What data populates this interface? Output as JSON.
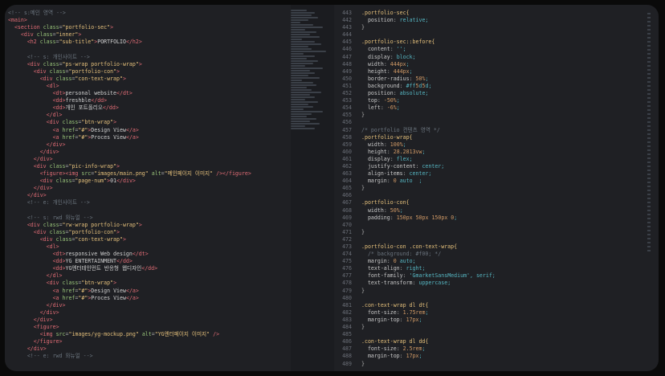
{
  "left_code": [
    "<!-- s:메인 영역 -->",
    "<main>",
    "  <section class=\"portfolio-sec\">",
    "    <div class=\"inner\">",
    "      <h2 class=\"sub-title\">PORTFOLIO</h2>",
    "",
    "      <!-- s: 개인사이트 -->",
    "      <div class=\"ps-wrap portfolio-wrap\">",
    "        <div class=\"portfolio-con\">",
    "          <div class=\"con-text-wrap\">",
    "            <dl>",
    "              <dt>personal website</dt>",
    "              <dd>freshble</dd>",
    "              <dd>개인 포트폴리오</dd>",
    "            </dl>",
    "            <div class=\"btn-wrap\">",
    "              <a href=\"#\">Design View</a>",
    "              <a href=\"#\">Proces View</a>",
    "            </div>",
    "          </div>",
    "        </div>",
    "        <div class=\"pic-info-wrap\">",
    "          <figure><img src=\"images/main.png\" alt=\"메인페이지 이미지\" /></figure>",
    "          <div class=\"page-num\">01</div>",
    "        </div>",
    "      </div>",
    "      <!-- e: 개인사이트 -->",
    "",
    "      <!-- s: rwd 와뉴얼 -->",
    "      <div class=\"rw-wrap portfolio-wrap\">",
    "        <div class=\"portfolio-con\">",
    "          <div class=\"con-text-wrap\">",
    "            <dl>",
    "              <dt>responsive Web design</dt>",
    "              <dd>YG ENTERTAINMENT</dd>",
    "              <dd>YG엔터테인먼트 반응형 웹디자인</dd>",
    "            </dl>",
    "            <div class=\"btn-wrap\">",
    "              <a href=\"#\">Design View</a>",
    "              <a href=\"#\">Proces View</a>",
    "            </div>",
    "          </div>",
    "        </div>",
    "        <figure>",
    "          <img src=\"images/yg-mockup.png\" alt=\"YG엔터페이지 이미지\" />",
    "        </figure>",
    "      </div>",
    "      <!-- e: rwd 와뉴얼 -->"
  ],
  "right_code": [
    {
      "n": "443",
      "t": ".portfolio-sec{"
    },
    {
      "n": "442",
      "t": "  position: relative;"
    },
    {
      "n": "443",
      "t": "}"
    },
    {
      "n": "444",
      "t": ""
    },
    {
      "n": "445",
      "t": ".portfolio-sec::before{"
    },
    {
      "n": "446",
      "t": "  content: '';"
    },
    {
      "n": "447",
      "t": "  display: block;"
    },
    {
      "n": "448",
      "t": "  width: 444px;"
    },
    {
      "n": "449",
      "t": "  height: 444px;"
    },
    {
      "n": "450",
      "t": "  border-radius: 50%;"
    },
    {
      "n": "451",
      "t": "  background: #ff5d5d;"
    },
    {
      "n": "452",
      "t": "  position: absolute;"
    },
    {
      "n": "453",
      "t": "  top: -50%;"
    },
    {
      "n": "454",
      "t": "  left: -6%;"
    },
    {
      "n": "455",
      "t": "}"
    },
    {
      "n": "456",
      "t": ""
    },
    {
      "n": "457",
      "t": "/* portfolio 컨텐츠 영역 */"
    },
    {
      "n": "458",
      "t": ".portfolio-wrap{"
    },
    {
      "n": "459",
      "t": "  width: 100%;"
    },
    {
      "n": "460",
      "t": "  height: 28.2813vw;"
    },
    {
      "n": "461",
      "t": "  display: flex;"
    },
    {
      "n": "462",
      "t": "  justify-content: center;"
    },
    {
      "n": "463",
      "t": "  align-items: center;"
    },
    {
      "n": "464",
      "t": "  margin: 0 auto  ;"
    },
    {
      "n": "465",
      "t": "}"
    },
    {
      "n": "466",
      "t": ""
    },
    {
      "n": "467",
      "t": ".portfolio-con{"
    },
    {
      "n": "468",
      "t": "  width: 50%;"
    },
    {
      "n": "469",
      "t": "  padding: 150px 50px 150px 0;"
    },
    {
      "n": "470",
      "t": ""
    },
    {
      "n": "471",
      "t": "}"
    },
    {
      "n": "472",
      "t": ""
    },
    {
      "n": "473",
      "t": ".portfolio-con .con-text-wrap{"
    },
    {
      "n": "474",
      "t": "  /* background: #f00; */"
    },
    {
      "n": "475",
      "t": "  margin: 0 auto;"
    },
    {
      "n": "476",
      "t": "  text-align: right;"
    },
    {
      "n": "477",
      "t": "  font-family: 'GmarketSansMedium', serif;"
    },
    {
      "n": "478",
      "t": "  text-transform: uppercase;"
    },
    {
      "n": "479",
      "t": "}"
    },
    {
      "n": "480",
      "t": ""
    },
    {
      "n": "481",
      "t": ".con-text-wrap dl dt{"
    },
    {
      "n": "482",
      "t": "  font-size: 1.75rem;"
    },
    {
      "n": "483",
      "t": "  margin-top: 17px;"
    },
    {
      "n": "484",
      "t": "}"
    },
    {
      "n": "485",
      "t": ""
    },
    {
      "n": "486",
      "t": ".con-text-wrap dl dd{"
    },
    {
      "n": "487",
      "t": "  font-size: 2.5rem;"
    },
    {
      "n": "488",
      "t": "  margin-top: 17px;"
    },
    {
      "n": "489",
      "t": "}"
    }
  ],
  "colors": {
    "background": "#1f2024",
    "swatch": "#ff5d5d"
  }
}
